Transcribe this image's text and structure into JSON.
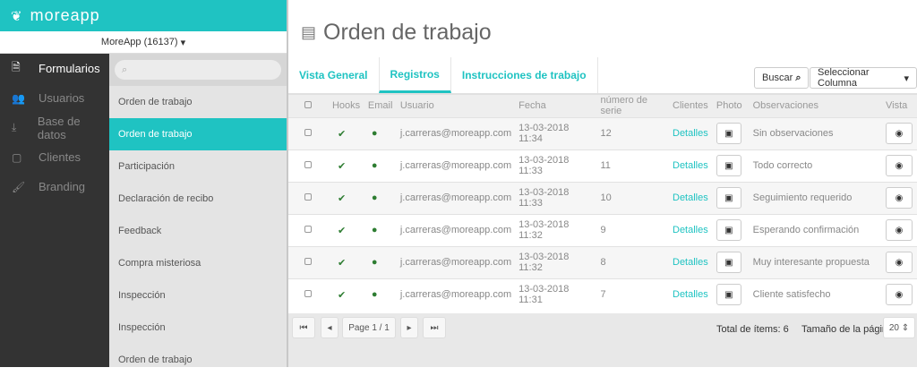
{
  "brand": {
    "logo_text": "moreapp"
  },
  "account": {
    "label": "MoreApp (16137)"
  },
  "nav": {
    "items": [
      {
        "label": "Formularios",
        "icon": "file-icon"
      },
      {
        "label": "Usuarios",
        "icon": "users-icon"
      },
      {
        "label": "Base de datos",
        "icon": "download-icon"
      },
      {
        "label": "Clientes",
        "icon": "tablet-icon"
      },
      {
        "label": "Branding",
        "icon": "brush-icon"
      }
    ]
  },
  "forms": {
    "search_placeholder": "",
    "items": [
      "Orden de trabajo",
      "Orden de trabajo",
      "Participación",
      "Declaración de recibo",
      "Feedback",
      "Compra misteriosa",
      "Inspección",
      "Inspección",
      "Orden de trabajo"
    ]
  },
  "page": {
    "title": "Orden de trabajo"
  },
  "tabs": [
    "Vista General",
    "Registros",
    "Instrucciones de trabajo"
  ],
  "toolbar": {
    "search": "Buscar",
    "columns": "Seleccionar Columna"
  },
  "table": {
    "headers": [
      "Hooks",
      "Email",
      "Usuario",
      "Fecha",
      "número de serie",
      "Clientes",
      "Photo",
      "Observaciones",
      "Vista"
    ],
    "rows": [
      {
        "user": "j.carreras@moreapp.com",
        "date": "13-03-2018 11:34",
        "serial": "12",
        "client": "Detalles",
        "obs": "Sin observaciones"
      },
      {
        "user": "j.carreras@moreapp.com",
        "date": "13-03-2018 11:33",
        "serial": "11",
        "client": "Detalles",
        "obs": "Todo correcto"
      },
      {
        "user": "j.carreras@moreapp.com",
        "date": "13-03-2018 11:33",
        "serial": "10",
        "client": "Detalles",
        "obs": "Seguimiento requerido"
      },
      {
        "user": "j.carreras@moreapp.com",
        "date": "13-03-2018 11:32",
        "serial": "9",
        "client": "Detalles",
        "obs": "Esperando confirmación"
      },
      {
        "user": "j.carreras@moreapp.com",
        "date": "13-03-2018 11:32",
        "serial": "8",
        "client": "Detalles",
        "obs": "Muy interesante propuesta"
      },
      {
        "user": "j.carreras@moreapp.com",
        "date": "13-03-2018 11:31",
        "serial": "7",
        "client": "Detalles",
        "obs": "Cliente satisfecho"
      }
    ]
  },
  "pager": {
    "page": "Page 1 / 1",
    "total": "Total de ítems: 6",
    "size_label": "Tamaño de la página",
    "size": "20"
  },
  "colors": {
    "accent": "#1fc3c2",
    "nav_bg": "#333333"
  }
}
